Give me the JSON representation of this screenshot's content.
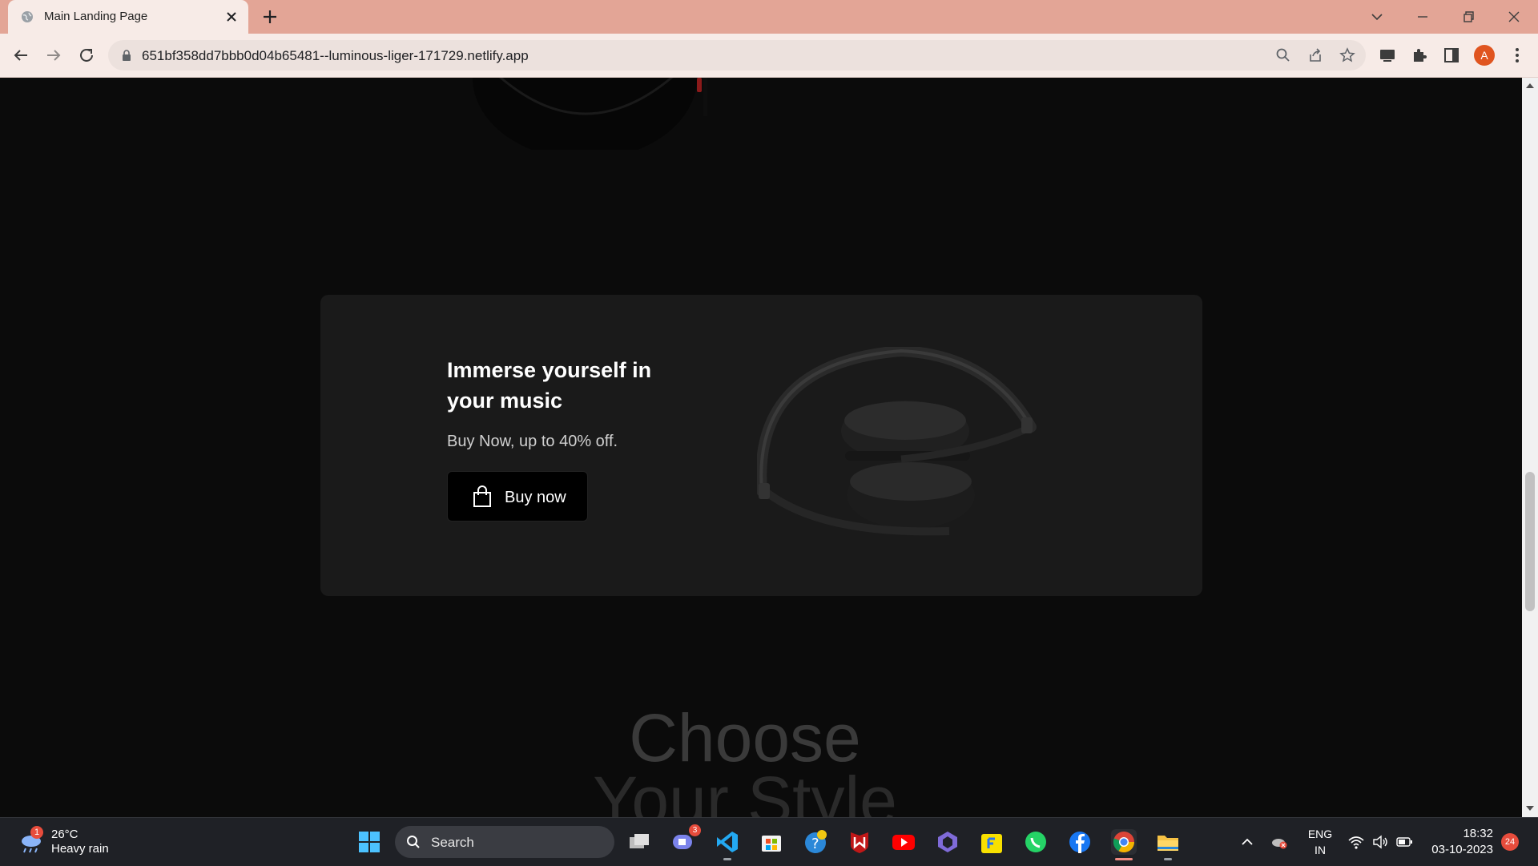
{
  "browser": {
    "tab_title": "Main Landing Page",
    "url": "651bf358dd7bbb0d04b65481--luminous-liger-171729.netlify.app",
    "profile_initial": "A"
  },
  "page": {
    "promo": {
      "heading": "Immerse yourself in your music",
      "subtext": "Buy Now, up to 40% off.",
      "button_label": "Buy now"
    },
    "section_title_line1": "Choose",
    "section_title_line2": "Your Style"
  },
  "taskbar": {
    "weather_badge": "1",
    "weather_temp": "26°C",
    "weather_desc": "Heavy rain",
    "search_label": "Search",
    "chat_badge": "3",
    "lang_line1": "ENG",
    "lang_line2": "IN",
    "time": "18:32",
    "date": "03-10-2023",
    "notification_count": "24"
  },
  "colors": {
    "titlebar": "#e3a596",
    "toolbar": "#f7ebe7",
    "page_bg": "#0b0b0b",
    "card_bg": "#1a1a1a",
    "button_bg": "#000000",
    "taskbar": "#1f2126"
  }
}
